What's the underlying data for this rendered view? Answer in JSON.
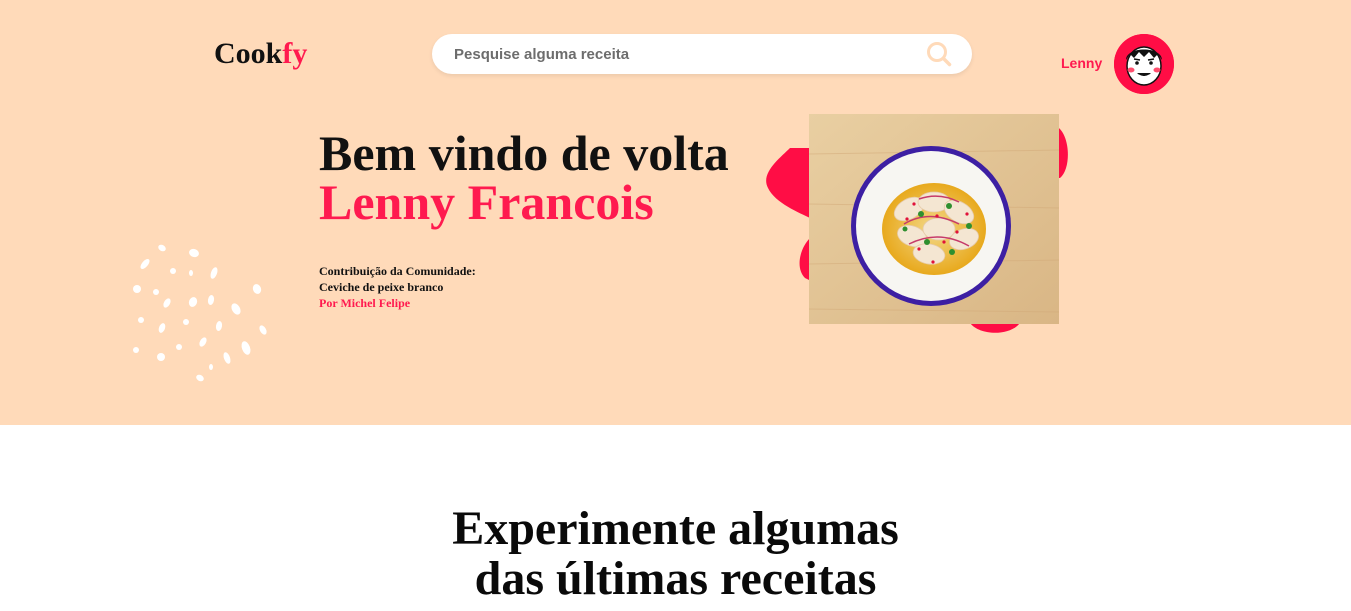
{
  "header": {
    "logo_part1": "Cook",
    "logo_part2": "fy",
    "search_placeholder": "Pesquise alguma receita",
    "search_icon": "search-icon",
    "username": "Lenny",
    "avatar_icon": "avatar-cartoon-face"
  },
  "hero": {
    "greeting": "Bem vindo de volta",
    "fullname": "Lenny Francois",
    "contribution_label": "Contribuição da Comunidade:",
    "recipe_name": "Ceviche de peixe branco",
    "author": "Por Michel Felipe"
  },
  "section": {
    "title_line1": "Experimente algumas",
    "title_line2": "das últimas receitas"
  },
  "colors": {
    "accent": "#ff1a4f",
    "hero_background": "#ffdab9",
    "text": "#111111"
  }
}
